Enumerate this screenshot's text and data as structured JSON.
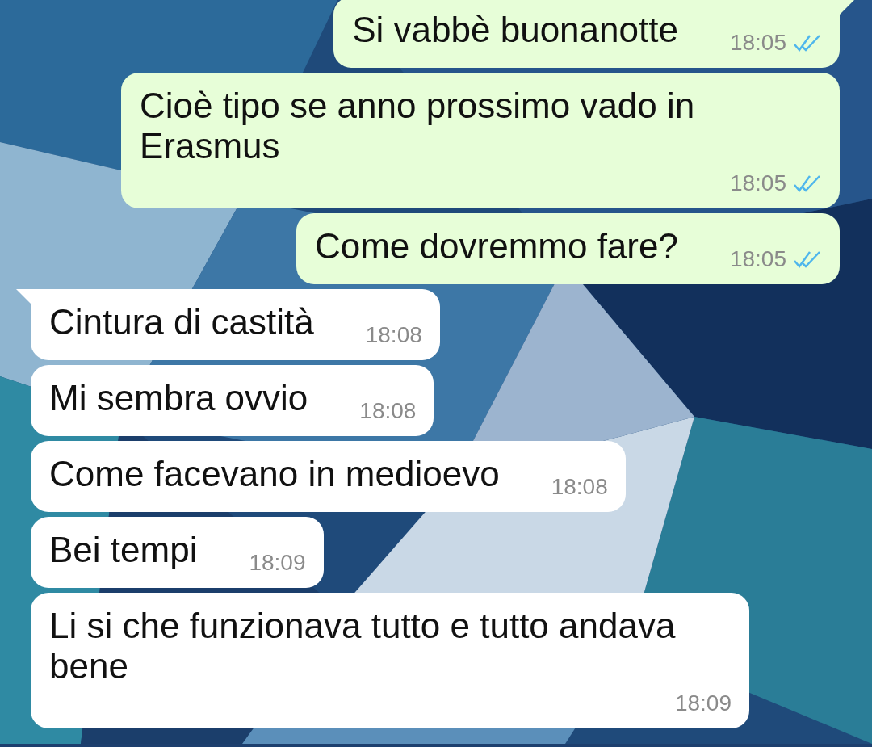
{
  "messages": [
    {
      "kind": "outgoing",
      "text": "Si vabbè buonanotte",
      "time": "18:05",
      "read": true,
      "tail": true
    },
    {
      "kind": "outgoing",
      "text": "Cioè tipo se anno prossimo vado in Erasmus",
      "time": "18:05",
      "read": true,
      "tail": false
    },
    {
      "kind": "outgoing",
      "text": "Come dovremmo fare?",
      "time": "18:05",
      "read": true,
      "tail": false
    },
    {
      "kind": "incoming",
      "text": "Cintura di castità",
      "time": "18:08",
      "tail": true
    },
    {
      "kind": "incoming",
      "text": "Mi sembra ovvio",
      "time": "18:08",
      "tail": false
    },
    {
      "kind": "incoming",
      "text": "Come facevano in medioevo",
      "time": "18:08",
      "tail": false
    },
    {
      "kind": "incoming",
      "text": "Bei tempi",
      "time": "18:09",
      "tail": false
    },
    {
      "kind": "incoming",
      "text": "Li si che funzionava tutto e tutto andava bene",
      "time": "18:09",
      "tail": false
    }
  ]
}
